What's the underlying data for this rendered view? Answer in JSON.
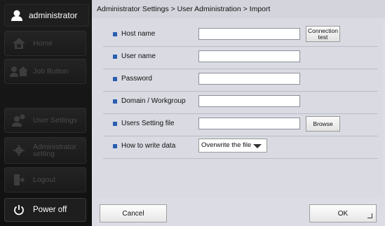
{
  "user": {
    "name": "administrator"
  },
  "sidebar": {
    "items": [
      {
        "label": "Home",
        "icon": "home-icon"
      },
      {
        "label": "Job Button",
        "icon": "job-button-icon"
      },
      {
        "label": "User Settings",
        "icon": "user-settings-icon"
      },
      {
        "label": "Administrator setting",
        "icon": "admin-settings-icon"
      },
      {
        "label": "Logout",
        "icon": "logout-icon"
      }
    ],
    "power": {
      "label": "Power off",
      "icon": "power-icon"
    }
  },
  "breadcrumb": "Administrator Settings > User Administration > Import",
  "form": {
    "host_name": {
      "label": "Host name",
      "value": "",
      "button": "Connection test"
    },
    "user_name": {
      "label": "User name",
      "value": ""
    },
    "password": {
      "label": "Password",
      "value": ""
    },
    "domain": {
      "label": "Domain / Workgroup",
      "value": ""
    },
    "users_setting_file": {
      "label": "Users Setting file",
      "value": "",
      "button": "Browse"
    },
    "write_mode": {
      "label": "How to write data",
      "value": "Overwrite the file"
    }
  },
  "footer": {
    "cancel": "Cancel",
    "ok": "OK"
  },
  "colors": {
    "bullet": "#2a5db0",
    "sidebar": "#141414",
    "main": "#dcdde4"
  }
}
